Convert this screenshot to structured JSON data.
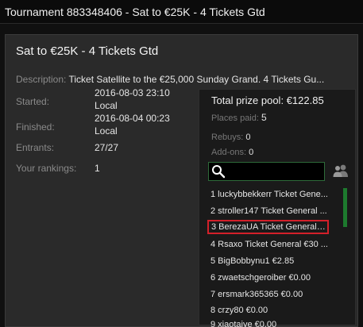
{
  "window": {
    "title": "Tournament 883348406 - Sat to €25K - 4 Tickets Gtd"
  },
  "panel": {
    "title": "Sat to €25K - 4 Tickets Gtd"
  },
  "details": {
    "description_label": "Description:",
    "description_value": "Ticket Satellite to the €25,000 Sunday Grand. 4 Tickets Gu...",
    "started_label": "Started:",
    "started_value_line1": "2016-08-03 23:10",
    "started_value_line2": "Local",
    "finished_label": "Finished:",
    "finished_value_line1": "2016-08-04 00:23",
    "finished_value_line2": "Local",
    "entrants_label": "Entrants:",
    "entrants_value": "27/27",
    "rankings_label": "Your rankings:",
    "rankings_value": "1"
  },
  "prize": {
    "total_label": "Total prize pool:",
    "total_value": "€122.85",
    "places_label": "Places paid:",
    "places_value": "5",
    "rebuys_label": "Rebuys:",
    "rebuys_value": "0",
    "addons_label": "Add-ons:",
    "addons_value": "0"
  },
  "search": {
    "value": "",
    "placeholder": ""
  },
  "icons": {
    "search": "search-icon",
    "players": "players-icon"
  },
  "colors": {
    "search_border": "#2e6b3a",
    "scrollbar": "#1d7a2e",
    "highlight": "#d3202a"
  },
  "rankings": [
    "1 luckybbekkerr Ticket Gene...",
    "2 stroller147 Ticket General ...",
    "3 BerezaUA Ticket General €...",
    "4 Rsaxo Ticket General €30 ...",
    "5 BigBobbynu1 €2.85",
    "6 zwaetschgeroiber €0.00",
    "7 ersmark365365 €0.00",
    "8 crzy80 €0.00",
    "9 xiaotaiye €0.00"
  ]
}
